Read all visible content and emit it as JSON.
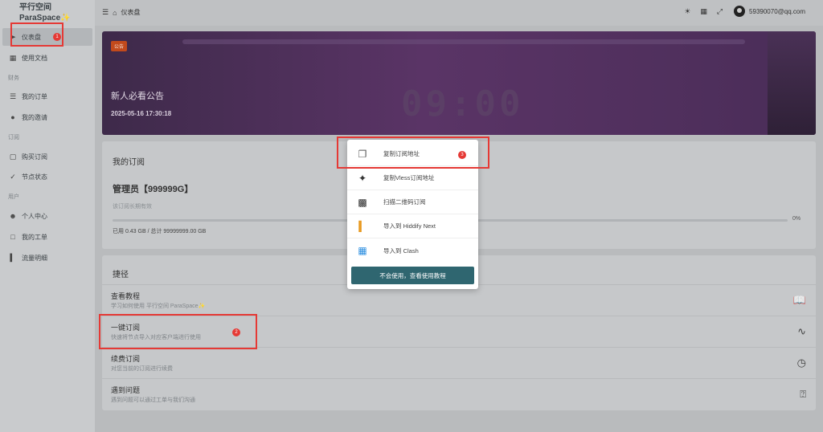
{
  "brand": {
    "line1": "平行空间",
    "line2": "ParaSpace✨"
  },
  "sidebar": {
    "items": [
      {
        "label": "仪表盘",
        "icon": "pointer-icon"
      },
      {
        "label": "使用文档",
        "icon": "book-icon"
      },
      {
        "label": "我的订单",
        "icon": "list-icon"
      },
      {
        "label": "我的邀请",
        "icon": "users-icon"
      },
      {
        "label": "购买订阅",
        "icon": "bag-icon"
      },
      {
        "label": "节点状态",
        "icon": "check-circle-icon"
      },
      {
        "label": "个人中心",
        "icon": "user-icon"
      },
      {
        "label": "我的工单",
        "icon": "chat-icon"
      },
      {
        "label": "流量明细",
        "icon": "bar-chart-icon"
      }
    ],
    "groups": {
      "finance": "财务",
      "subscription": "订阅",
      "user": "用户"
    }
  },
  "header": {
    "breadcrumb": "仪表盘",
    "email": "59390070@qq.com"
  },
  "announcement": {
    "badge": "公告",
    "title": "新人必看公告",
    "date": "2025-05-16 17:30:18",
    "clock": "09:00"
  },
  "subscription": {
    "card_title": "我的订阅",
    "name": "管理员【999999G】",
    "validity": "该订阅长期有效",
    "usage": "已用 0.43 GB / 总计 99999999.00 GB",
    "percent_label": "0%",
    "percent": 0
  },
  "shortcuts": {
    "title": "捷径",
    "items": [
      {
        "title": "查看教程",
        "desc": "学习如何使用 平行空间 ParaSpace✨",
        "icon": "book-icon"
      },
      {
        "title": "一键订阅",
        "desc": "快速将节点导入对应客户端进行使用",
        "icon": "rss-icon"
      },
      {
        "title": "续费订阅",
        "desc": "对您当前的订阅进行续费",
        "icon": "clock-icon"
      },
      {
        "title": "遇到问题",
        "desc": "遇到问题可以通过工单与我们沟通",
        "icon": "help-icon"
      }
    ]
  },
  "popup": {
    "items": [
      {
        "label": "复制订阅地址",
        "icon": "copy-icon"
      },
      {
        "label": "复制Vless订阅地址",
        "icon": "vless-icon"
      },
      {
        "label": "扫描二维码订阅",
        "icon": "qrcode-icon"
      },
      {
        "label": "导入到 Hiddify Next",
        "icon": "hiddify-icon"
      },
      {
        "label": "导入到 Clash",
        "icon": "clash-icon"
      }
    ],
    "button": "不会使用，查看使用教程"
  },
  "annotations": {
    "n1": "1",
    "n2": "2",
    "n3": "3"
  },
  "colors": {
    "accent": "#2f6670",
    "badge": "#c24a1c",
    "annotation": "#e53935"
  }
}
